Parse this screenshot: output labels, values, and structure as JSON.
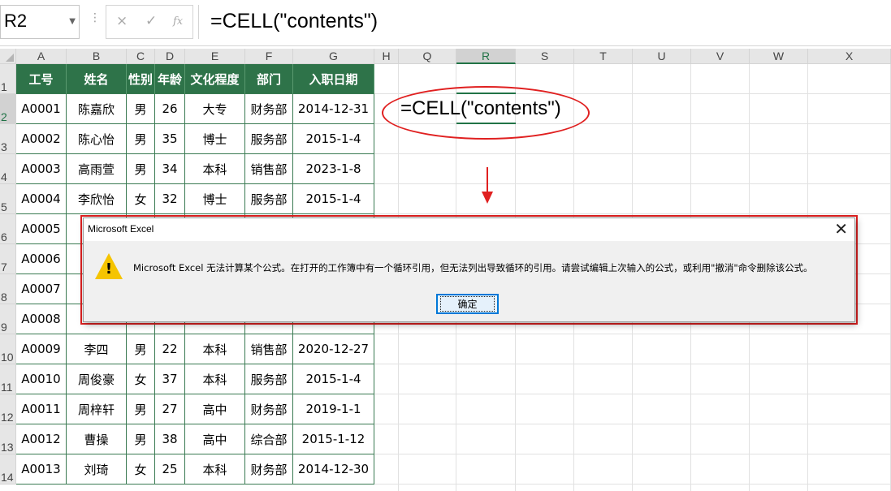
{
  "formula_bar": {
    "name_box": "R2",
    "cancel_icon": "×",
    "enter_icon": "✓",
    "fx_icon": "fx",
    "formula": "=CELL(\"contents\")"
  },
  "columns": [
    "A",
    "B",
    "C",
    "D",
    "E",
    "F",
    "G",
    "H",
    "Q",
    "R",
    "S",
    "T",
    "U",
    "V",
    "W",
    "X"
  ],
  "rows": [
    "1",
    "2",
    "3",
    "4",
    "5",
    "6",
    "7",
    "8",
    "9",
    "10",
    "11",
    "12",
    "13",
    "14"
  ],
  "table": {
    "headers": [
      "工号",
      "姓名",
      "性别",
      "年龄",
      "文化程度",
      "部门",
      "入职日期"
    ],
    "rows": [
      [
        "A0001",
        "陈嘉欣",
        "男",
        "26",
        "大专",
        "财务部",
        "2014-12-31"
      ],
      [
        "A0002",
        "陈心怡",
        "男",
        "35",
        "博士",
        "服务部",
        "2015-1-4"
      ],
      [
        "A0003",
        "高雨萱",
        "男",
        "34",
        "本科",
        "销售部",
        "2023-1-8"
      ],
      [
        "A0004",
        "李欣怡",
        "女",
        "32",
        "博士",
        "服务部",
        "2015-1-4"
      ],
      [
        "A0005",
        "",
        "",
        "",
        "",
        "",
        ""
      ],
      [
        "A0006",
        "",
        "",
        "",
        "",
        "",
        ""
      ],
      [
        "A0007",
        "",
        "",
        "",
        "",
        "",
        ""
      ],
      [
        "A0008",
        "",
        "",
        "",
        "",
        "",
        ""
      ],
      [
        "A0009",
        "李四",
        "男",
        "22",
        "本科",
        "销售部",
        "2020-12-27"
      ],
      [
        "A0010",
        "周俊豪",
        "女",
        "37",
        "本科",
        "服务部",
        "2015-1-4"
      ],
      [
        "A0011",
        "周梓轩",
        "男",
        "27",
        "高中",
        "财务部",
        "2019-1-1"
      ],
      [
        "A0012",
        "曹操",
        "男",
        "38",
        "高中",
        "综合部",
        "2015-1-12"
      ],
      [
        "A0013",
        "刘琦",
        "女",
        "25",
        "本科",
        "财务部",
        "2014-12-30"
      ]
    ]
  },
  "annotation": {
    "formula_text": "=CELL(\"contents\")"
  },
  "dialog": {
    "title": "Microsoft Excel",
    "close_icon": "✕",
    "message": "Microsoft Excel 无法计算某个公式。在打开的工作簿中有一个循环引用，但无法列出导致循环的引用。请尝试编辑上次输入的公式，或利用\"撤消\"命令删除该公式。",
    "warning_mark": "!",
    "ok_label": "确定"
  },
  "colors": {
    "header_fill": "#2e7349",
    "selection": "#217346",
    "annotation_red": "#e02020",
    "warning_yellow": "#f5c400"
  }
}
